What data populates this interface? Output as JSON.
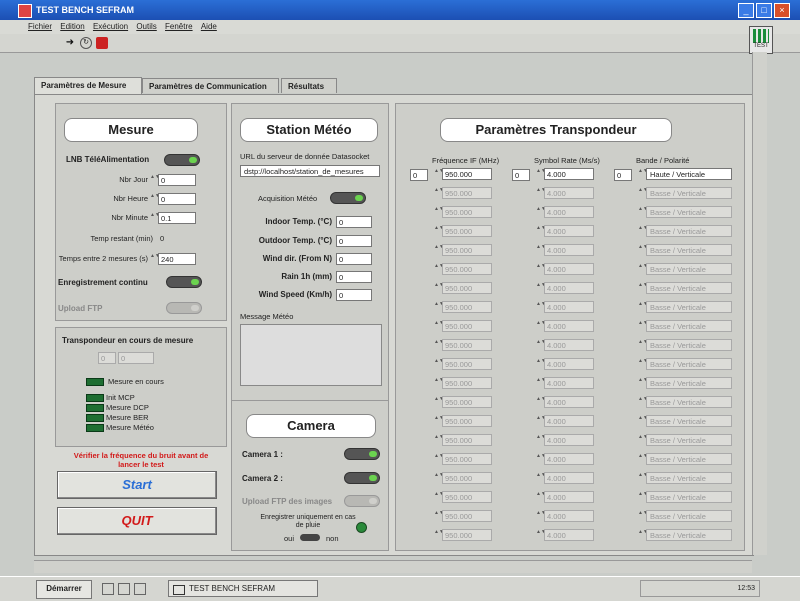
{
  "window": {
    "title": "TEST BENCH SEFRAM",
    "vi_icon_label": "TEST"
  },
  "menu": [
    "Fichier",
    "Edition",
    "Exécution",
    "Outils",
    "Fenêtre",
    "Aide"
  ],
  "tabs": [
    "Paramètres de Mesure",
    "Paramètres de Communication",
    "Résultats"
  ],
  "mesure": {
    "title": "Mesure",
    "lnb_label": "LNB TéléAlimentation",
    "fields": [
      {
        "label": "Nbr Jour",
        "value": "0"
      },
      {
        "label": "Nbr Heure",
        "value": "0"
      },
      {
        "label": "Nbr Minute",
        "value": "0.1"
      },
      {
        "label": "Temp restant (min)",
        "value": "0"
      },
      {
        "label": "Temps entre 2 mesures (s)",
        "value": "240"
      }
    ],
    "enregistrement_label": "Enregistrement continu",
    "upload_label": "Upload FTP",
    "transpondeur_label": "Transpondeur en cours de mesure",
    "transpondeur_values": [
      "0",
      "0"
    ],
    "mesure_en_cours": "Mesure en cours",
    "steps": [
      "Init MCP",
      "Mesure DCP",
      "Mesure BER",
      "Mesure Météo"
    ],
    "warning": "Vérifier la fréquence du bruit avant de lancer le test",
    "start_label": "Start",
    "quit_label": "QUIT"
  },
  "meteo": {
    "title": "Station Météo",
    "url_label": "URL du serveur de donnée Datasocket",
    "url_value": "dstp://localhost/station_de_mesures",
    "acquisition_label": "Acquisition Météo",
    "fields": [
      {
        "label": "Indoor Temp. (°C)",
        "value": "0"
      },
      {
        "label": "Outdoor Temp. (°C)",
        "value": "0"
      },
      {
        "label": "Wind dir. (From N)",
        "value": "0"
      },
      {
        "label": "Rain 1h (mm)",
        "value": "0"
      },
      {
        "label": "Wind Speed (Km/h)",
        "value": "0"
      }
    ],
    "message_label": "Message Météo",
    "message_value": ""
  },
  "camera": {
    "title": "Camera",
    "camera1_label": "Camera 1 :",
    "camera2_label": "Camera 2 :",
    "upload_label": "Upload FTP des images",
    "rain_label": "Enregistrer uniquement en cas de pluie",
    "oui": "oui",
    "non": "non"
  },
  "transpondeur": {
    "title": "Paramètres Transpondeur",
    "col_freq": "Fréquence IF (MHz)",
    "col_sr": "Symbol Rate (Ms/s)",
    "col_band": "Bande / Polarité",
    "index_freq": "0",
    "index_sr": "0",
    "index_band": "0",
    "rows": [
      {
        "freq": "950.000",
        "sr": "4.000",
        "band": "Haute / Verticale"
      },
      {
        "freq": "950.000",
        "sr": "4.000",
        "band": "Basse / Verticale"
      },
      {
        "freq": "950.000",
        "sr": "4.000",
        "band": "Basse / Verticale"
      },
      {
        "freq": "950.000",
        "sr": "4.000",
        "band": "Basse / Verticale"
      },
      {
        "freq": "950.000",
        "sr": "4.000",
        "band": "Basse / Verticale"
      },
      {
        "freq": "950.000",
        "sr": "4.000",
        "band": "Basse / Verticale"
      },
      {
        "freq": "950.000",
        "sr": "4.000",
        "band": "Basse / Verticale"
      },
      {
        "freq": "950.000",
        "sr": "4.000",
        "band": "Basse / Verticale"
      },
      {
        "freq": "950.000",
        "sr": "4.000",
        "band": "Basse / Verticale"
      },
      {
        "freq": "950.000",
        "sr": "4.000",
        "band": "Basse / Verticale"
      },
      {
        "freq": "950.000",
        "sr": "4.000",
        "band": "Basse / Verticale"
      },
      {
        "freq": "950.000",
        "sr": "4.000",
        "band": "Basse / Verticale"
      },
      {
        "freq": "950.000",
        "sr": "4.000",
        "band": "Basse / Verticale"
      },
      {
        "freq": "950.000",
        "sr": "4.000",
        "band": "Basse / Verticale"
      },
      {
        "freq": "950.000",
        "sr": "4.000",
        "band": "Basse / Verticale"
      },
      {
        "freq": "950.000",
        "sr": "4.000",
        "band": "Basse / Verticale"
      },
      {
        "freq": "950.000",
        "sr": "4.000",
        "band": "Basse / Verticale"
      },
      {
        "freq": "950.000",
        "sr": "4.000",
        "band": "Basse / Verticale"
      },
      {
        "freq": "950.000",
        "sr": "4.000",
        "band": "Basse / Verticale"
      },
      {
        "freq": "950.000",
        "sr": "4.000",
        "band": "Basse / Verticale"
      }
    ]
  },
  "taskbar": {
    "start_label": "Démarrer",
    "task_label": "TEST BENCH SEFRAM",
    "clock": "12:53"
  },
  "colors": {
    "title_blue": "#1c4fb3",
    "led_green": "#1e6e32",
    "start_text": "#2a6fd6",
    "quit_text": "#d21a1a",
    "warning_text": "#d21a1a"
  }
}
